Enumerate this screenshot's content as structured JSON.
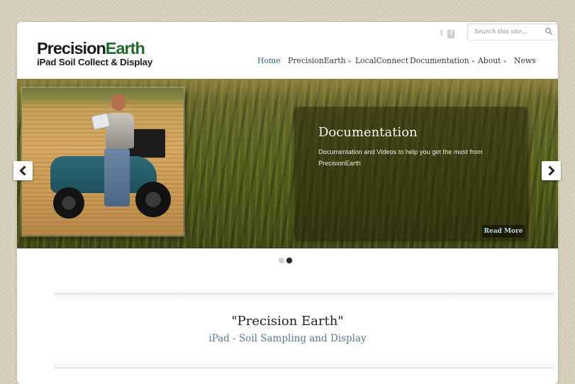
{
  "header": {
    "logo_line1_a": "Precision",
    "logo_line1_b": "Earth",
    "logo_line2": "iPad Soil Collect & Display",
    "social": {
      "twitter_glyph": "t",
      "facebook_glyph": "f"
    },
    "search": {
      "placeholder": "Search this site...",
      "icon": "search-icon"
    }
  },
  "nav": {
    "items": [
      {
        "label": "Home",
        "active": true,
        "has_submenu": false
      },
      {
        "label": "PrecisionEarth",
        "active": false,
        "has_submenu": true
      },
      {
        "label": "LocalConnect",
        "active": false,
        "has_submenu": false
      },
      {
        "label": "Documentation",
        "active": false,
        "has_submenu": true
      },
      {
        "label": "About",
        "active": false,
        "has_submenu": true
      },
      {
        "label": "News",
        "active": false,
        "has_submenu": false
      }
    ],
    "submenu_glyph": "»"
  },
  "slider": {
    "caption_title": "Documentation",
    "caption_text": "Documentation and Videos to help you get the most from PrecisionEarth",
    "read_more": "Read More",
    "total_slides": 2,
    "active_slide": 2
  },
  "intro": {
    "headline": "\"Precision Earth\"",
    "subheadline": "iPad - Soil Sampling and Display"
  },
  "colors": {
    "brand_green": "#1d6b2a",
    "nav_active": "#2f5f7a",
    "subhead_teal": "#4f7d8e"
  }
}
